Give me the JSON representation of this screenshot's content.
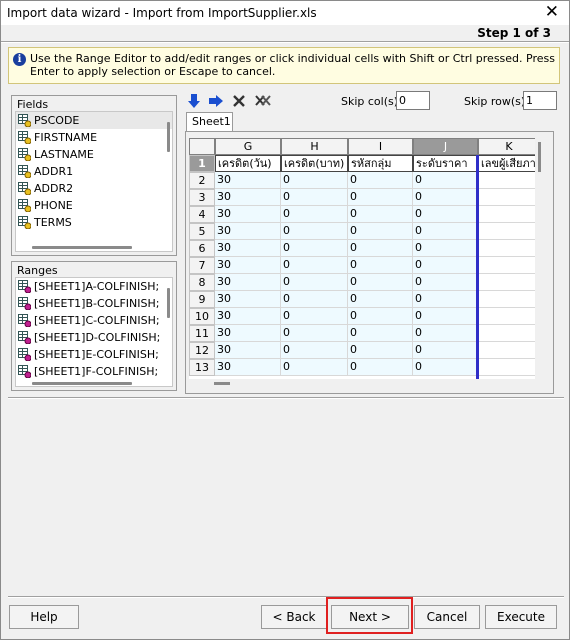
{
  "window": {
    "title": "Import data wizard - Import from ImportSupplier.xls",
    "step": "Step 1 of 3"
  },
  "info": {
    "text": "Use the Range Editor to add/edit ranges or click individual cells with Shift or Ctrl pressed. Press Enter to apply selection or Escape to cancel."
  },
  "fields": {
    "title": "Fields",
    "items": [
      "PSCODE",
      "FIRSTNAME",
      "LASTNAME",
      "ADDR1",
      "ADDR2",
      "PHONE",
      "TERMS"
    ]
  },
  "ranges": {
    "title": "Ranges",
    "items": [
      "[SHEET1]A-COLFINISH;",
      "[SHEET1]B-COLFINISH;",
      "[SHEET1]C-COLFINISH;",
      "[SHEET1]D-COLFINISH;",
      "[SHEET1]E-COLFINISH;",
      "[SHEET1]F-COLFINISH;"
    ]
  },
  "toolbar": {
    "skip_cols_label": "Skip col(s)",
    "skip_cols_value": "0",
    "skip_rows_label": "Skip row(s)",
    "skip_rows_value": "1"
  },
  "sheet": {
    "tab": "Sheet1",
    "columns": [
      "G",
      "H",
      "I",
      "J",
      "K"
    ],
    "selected_column": "J",
    "header_row": [
      "เครดิต(วัน)",
      "เครดิต(บาท)",
      "รหัสกลุ่ม",
      "ระดับราคา",
      "เลขผู้เสียภาษี"
    ],
    "rows": [
      {
        "n": "2",
        "cells": [
          "30",
          "0",
          "0",
          "0",
          ""
        ]
      },
      {
        "n": "3",
        "cells": [
          "30",
          "0",
          "0",
          "0",
          ""
        ]
      },
      {
        "n": "4",
        "cells": [
          "30",
          "0",
          "0",
          "0",
          ""
        ]
      },
      {
        "n": "5",
        "cells": [
          "30",
          "0",
          "0",
          "0",
          ""
        ]
      },
      {
        "n": "6",
        "cells": [
          "30",
          "0",
          "0",
          "0",
          ""
        ]
      },
      {
        "n": "7",
        "cells": [
          "30",
          "0",
          "0",
          "0",
          ""
        ]
      },
      {
        "n": "8",
        "cells": [
          "30",
          "0",
          "0",
          "0",
          ""
        ]
      },
      {
        "n": "9",
        "cells": [
          "30",
          "0",
          "0",
          "0",
          ""
        ]
      },
      {
        "n": "10",
        "cells": [
          "30",
          "0",
          "0",
          "0",
          ""
        ]
      },
      {
        "n": "11",
        "cells": [
          "30",
          "0",
          "0",
          "0",
          ""
        ]
      },
      {
        "n": "12",
        "cells": [
          "30",
          "0",
          "0",
          "0",
          ""
        ]
      },
      {
        "n": "13",
        "cells": [
          "30",
          "0",
          "0",
          "0",
          ""
        ]
      }
    ],
    "first_row_number": "1"
  },
  "buttons": {
    "help": "Help",
    "back": "< Back",
    "next": "Next >",
    "cancel": "Cancel",
    "execute": "Execute"
  },
  "colors": {
    "selection_line": "#2e2ec8",
    "highlight_box": "#e02020",
    "info_background": "#fffde1",
    "cell_tint": "#eefaff"
  }
}
